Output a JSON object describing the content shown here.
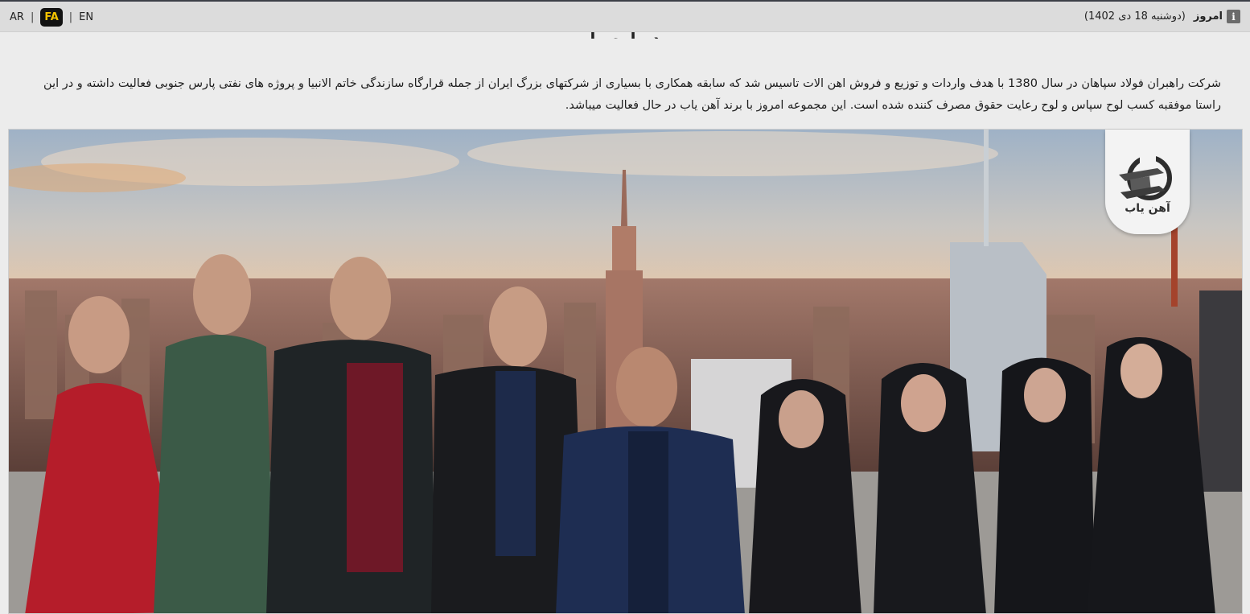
{
  "topbar": {
    "languages": [
      "AR",
      "FA",
      "EN"
    ],
    "active_language": "FA",
    "today_label": "امروز",
    "today_date": "(دوشنبه  18 دی 1402)",
    "info_icon": "info-icon"
  },
  "about": {
    "heading": "درباره ما",
    "paragraph": "شرکت راهبران فولاد سپاهان در سال 1380 با هدف واردات و توزیع و فروش اهن الات تاسیس شد که سابقه همکاری با بسیاری از شرکتهای بزرگ ایران از جمله قرارگاه سازندگی خاتم الانبیا و پروژه های نفتی پارس جنوبی فعالیت داشته و در این راستا موفقبه کسب لوح سپاس و لوح رعایت حقوق مصرف کننده شده است. این مجموعه امروز با برند آهن یاب در حال فعالیت میباشد."
  },
  "photo": {
    "logo_text": "آهن یاب",
    "logo_icon": "steel-beam-icon"
  }
}
